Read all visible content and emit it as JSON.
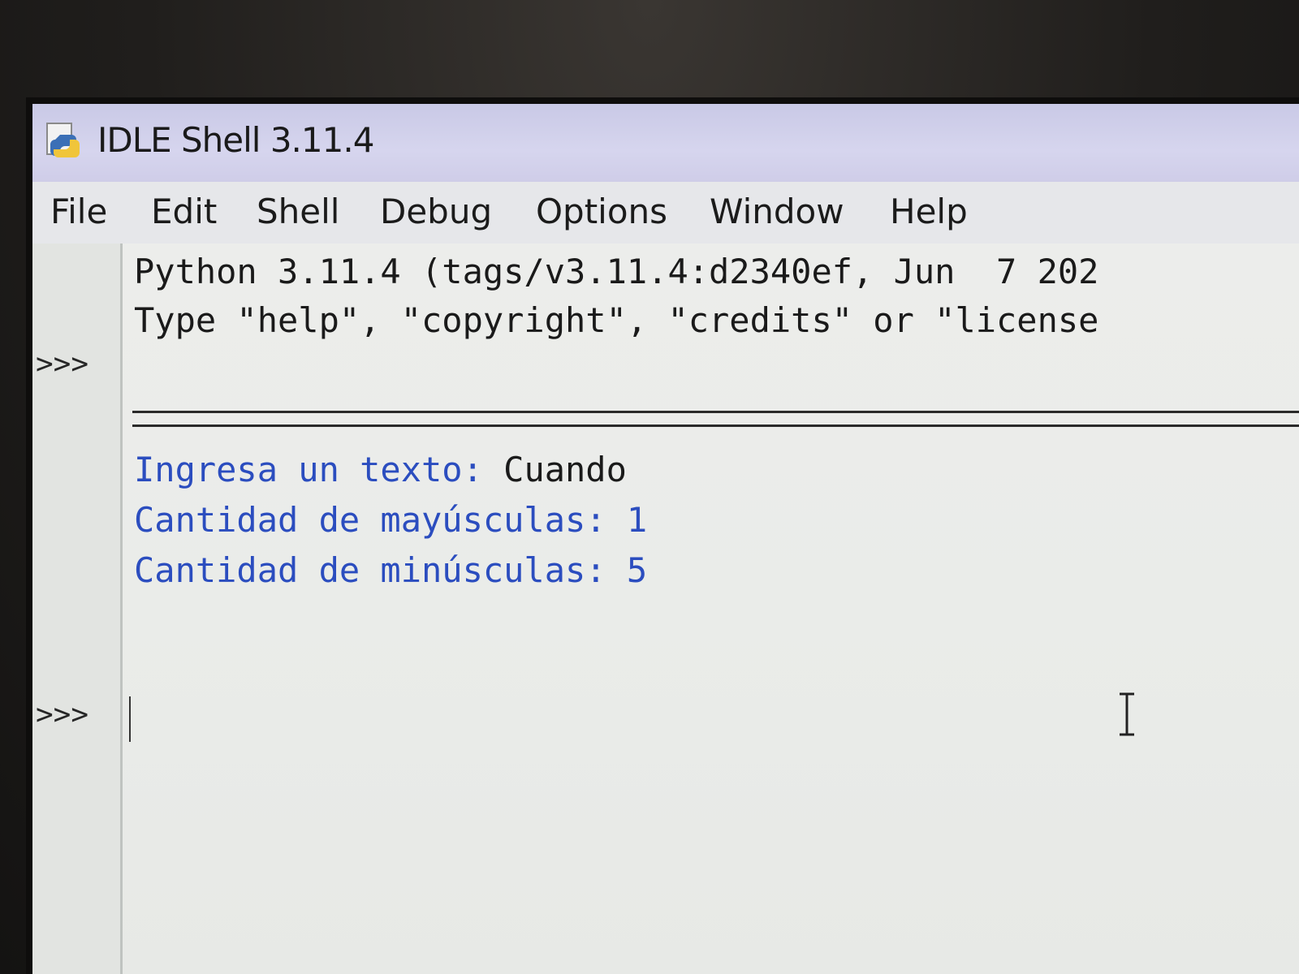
{
  "window": {
    "title": "IDLE Shell 3.11.4"
  },
  "menu": {
    "items": [
      "File",
      "Edit",
      "Shell",
      "Debug",
      "Options",
      "Window",
      "Help"
    ]
  },
  "shell": {
    "banner_line_1": "Python 3.11.4 (tags/v3.11.4:d2340ef, Jun  7 202",
    "banner_line_2": "Type \"help\", \"copyright\", \"credits\" or \"license",
    "prompt": ">>>",
    "prompt_2": ">>>",
    "output_1_label": "Ingresa un texto: ",
    "output_1_input": "Cuando",
    "output_2": "Cantidad de mayúsculas: 1",
    "output_3": "Cantidad de minúsculas: 5"
  },
  "colors": {
    "stdout": "#2b4dbf",
    "user_input": "#1a1a1a",
    "titlebar": "#d6d5ee"
  },
  "icons": {
    "app": "python-idle-icon",
    "cursor": "text-ibeam-cursor"
  }
}
